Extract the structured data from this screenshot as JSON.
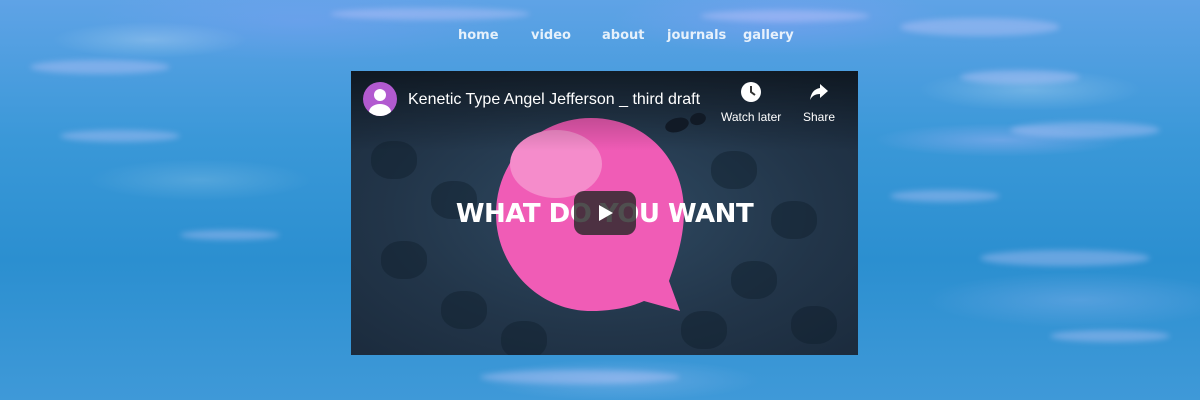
{
  "nav": {
    "items": [
      "home",
      "video",
      "about",
      "journals",
      "gallery"
    ]
  },
  "video": {
    "title": "Kenetic Type Angel Jefferson _ third draft",
    "overlay_text": "WHAT DO YOU WANT",
    "watch_later_label": "Watch later",
    "share_label": "Share",
    "icons": {
      "avatar": "channel-avatar-icon",
      "watch_later": "clock-icon",
      "share": "share-arrow-icon",
      "play": "play-icon"
    }
  },
  "colors": {
    "avatar": "#b25ad0",
    "bubble": "#f05cb6",
    "water": "#2b8fd0"
  }
}
